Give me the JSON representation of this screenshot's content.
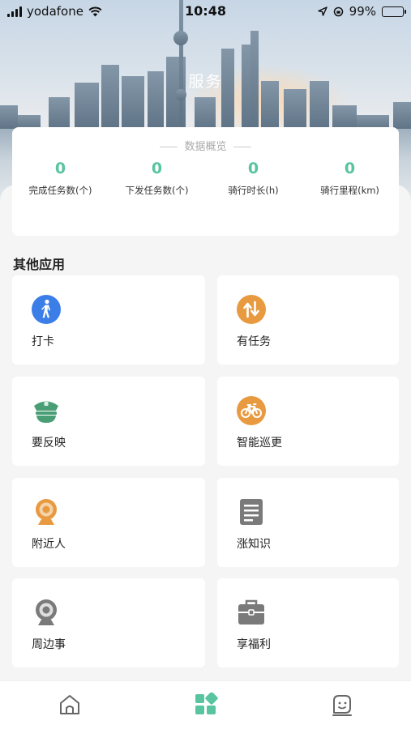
{
  "status_bar": {
    "carrier": "yodafone",
    "time": "10:48",
    "battery": "99%",
    "battery_level": 0.99
  },
  "header": {
    "title": "服务"
  },
  "stats": {
    "heading": "数据概览",
    "items": [
      {
        "value": "0",
        "label": "完成任务数(个)"
      },
      {
        "value": "0",
        "label": "下发任务数(个)"
      },
      {
        "value": "0",
        "label": "骑行时长(h)"
      },
      {
        "value": "0",
        "label": "骑行里程(km)"
      }
    ]
  },
  "apps_section": {
    "title": "其他应用",
    "items": [
      {
        "label": "打卡",
        "icon": "walk-icon"
      },
      {
        "label": "有任务",
        "icon": "swap-arrows-icon"
      },
      {
        "label": "要反映",
        "icon": "police-cap-icon"
      },
      {
        "label": "智能巡更",
        "icon": "bicycle-icon"
      },
      {
        "label": "附近人",
        "icon": "webcam-icon"
      },
      {
        "label": "涨知识",
        "icon": "document-icon"
      },
      {
        "label": "周边事",
        "icon": "camera-icon"
      },
      {
        "label": "享福利",
        "icon": "briefcase-icon"
      }
    ]
  },
  "tabbar": {
    "tabs": [
      "home-icon",
      "apps-icon",
      "profile-icon"
    ],
    "active": 1
  },
  "colors": {
    "accent": "#58c4a0",
    "orange": "#e89a40",
    "blue": "#3b7ee8",
    "green": "#4a9e76",
    "gray": "#7a7a7a"
  }
}
